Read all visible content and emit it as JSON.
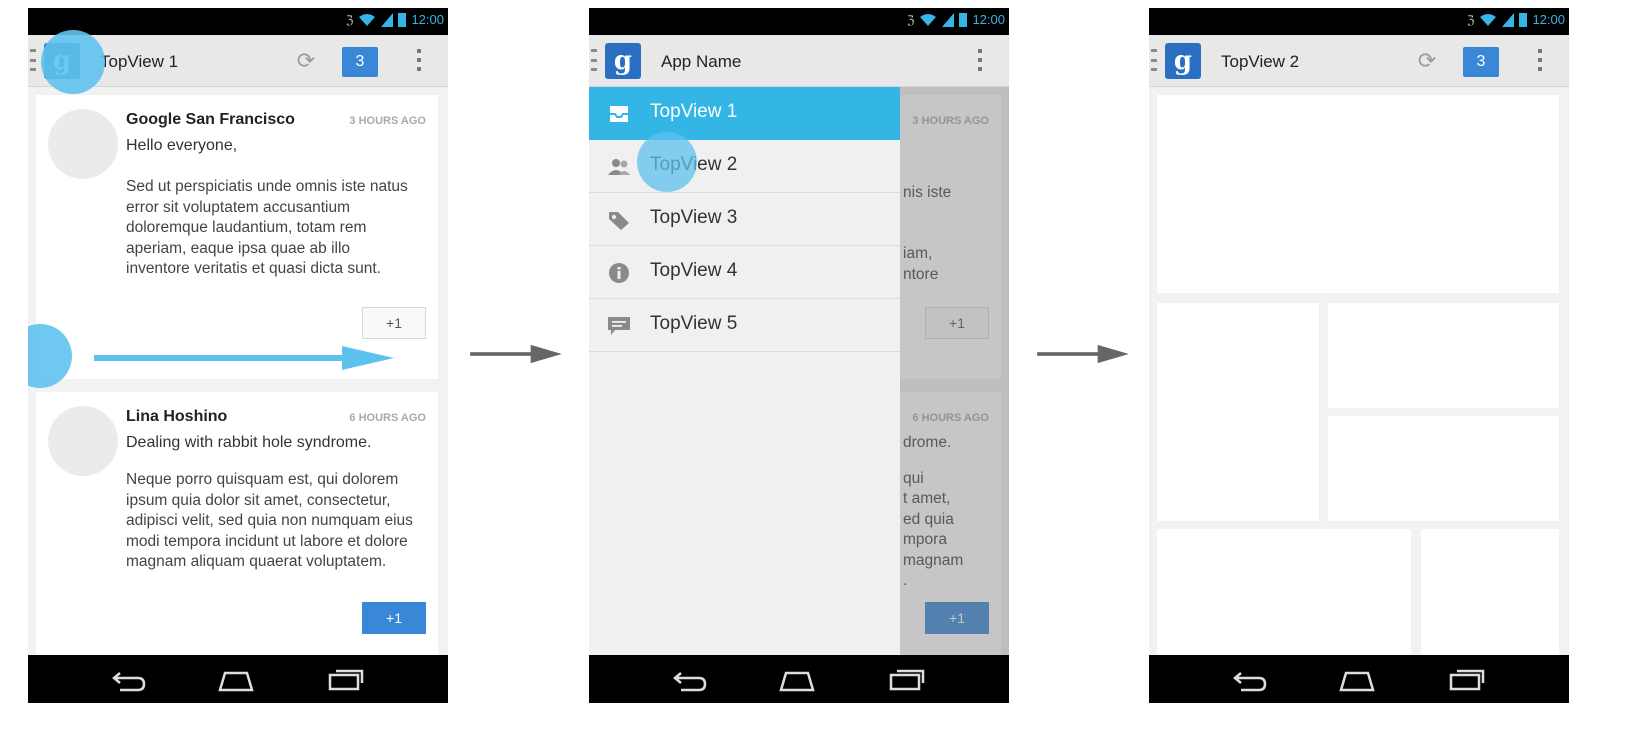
{
  "status": {
    "time": "12:00"
  },
  "colors": {
    "accent": "#33b5e5",
    "badge_blue": "#3a87d8",
    "touch": "#5ec2ee"
  },
  "screen1": {
    "title": "TopView 1",
    "badge": "3",
    "posts": [
      {
        "author": "Google San Francisco",
        "time": "3 HOURS AGO",
        "subject": "Hello everyone,",
        "body": "Sed ut perspiciatis unde omnis iste natus error sit voluptatem accusantium doloremque laudantium, totam rem aperiam, eaque ipsa quae ab illo inventore veritatis et quasi dicta sunt.",
        "plus_label": "+1"
      },
      {
        "author": "Lina Hoshino",
        "time": "6 HOURS AGO",
        "subject": "Dealing with rabbit hole syndrome.",
        "body": "Neque porro quisquam est, qui dolorem ipsum quia dolor sit amet, consectetur, adipisci velit, sed quia non numquam eius modi tempora incidunt ut labore et dolore magnam aliquam quaerat voluptatem.",
        "plus_label": "+1"
      }
    ]
  },
  "screen2": {
    "title": "App Name",
    "drawer_items": [
      {
        "label": "TopView 1",
        "icon": "inbox-icon"
      },
      {
        "label": "TopView 2",
        "icon": "people-icon"
      },
      {
        "label": "TopView 3",
        "icon": "tag-icon"
      },
      {
        "label": "TopView 4",
        "icon": "info-icon"
      },
      {
        "label": "TopView 5",
        "icon": "chat-icon"
      }
    ],
    "behind": {
      "time1": "3 HOURS AGO",
      "time2": "6 HOURS AGO",
      "frag1": "nis iste",
      "frag2": "iam,",
      "frag3": "ntore",
      "frag4": "drome.",
      "frag5": "qui",
      "frag6": "t amet,",
      "frag7": "ed quia",
      "frag8": "mpora",
      "frag9": "magnam",
      "frag10": ".",
      "plus": "+1"
    }
  },
  "screen3": {
    "title": "TopView 2",
    "badge": "3"
  }
}
